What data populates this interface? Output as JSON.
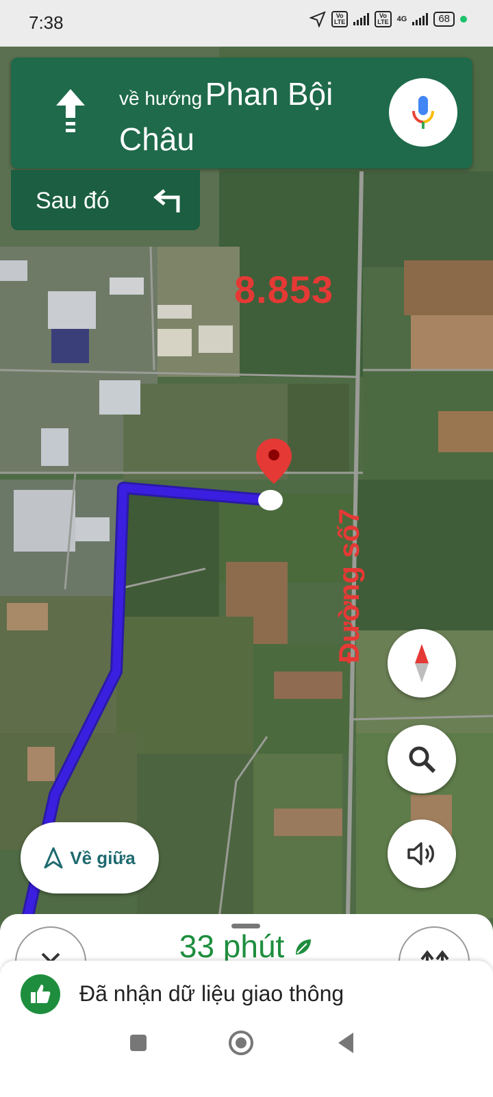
{
  "status_bar": {
    "time": "7:38",
    "network": "4G",
    "battery": "68",
    "volte_label": "Vo LTE"
  },
  "navigation": {
    "direction_prefix": "về hướng",
    "street_line1": "Phan Bội",
    "street_line2": "Châu",
    "then_label": "Sau đó",
    "then_icon": "turn-left-icon",
    "accent_color": "#1e6a4a"
  },
  "map": {
    "overlay_number": "8.853",
    "road_label": "Đường số7",
    "route_color": "#3b1fe0",
    "pin_color": "#e53935"
  },
  "controls": {
    "recenter_label": "Về giữa"
  },
  "trip": {
    "eta": "33 phút",
    "eta_color": "#1e8e3e"
  },
  "toast": {
    "message": "Đã nhận dữ liệu giao thông"
  }
}
